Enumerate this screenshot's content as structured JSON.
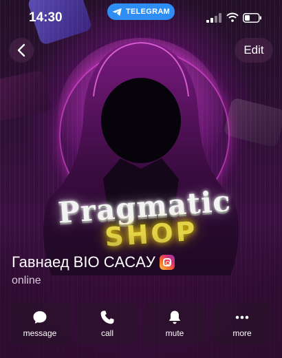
{
  "status_bar": {
    "time": "14:30",
    "pill_label": "TELEGRAM",
    "pill_color": "#2f8ef3"
  },
  "nav": {
    "back_icon": "chevron-left-icon",
    "edit_label": "Edit"
  },
  "avatar_art": {
    "word_primary": "Pragmatic",
    "word_secondary": "SHOP",
    "accent_color": "#ff3ce6"
  },
  "profile": {
    "name": "Гавнаед BIO CACAУ",
    "badge_icon": "instagram-icon",
    "status": "online"
  },
  "actions": [
    {
      "label": "message",
      "icon": "chat-bubble-icon"
    },
    {
      "label": "call",
      "icon": "phone-icon"
    },
    {
      "label": "mute",
      "icon": "bell-icon"
    },
    {
      "label": "more",
      "icon": "more-dots-icon"
    }
  ]
}
